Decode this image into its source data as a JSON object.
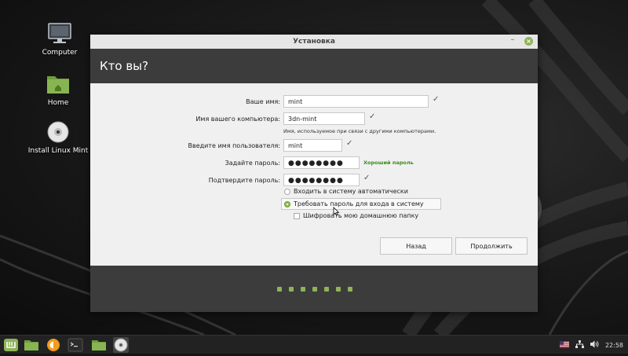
{
  "desktop": {
    "icons": [
      {
        "label": "Computer",
        "icon": "computer-icon"
      },
      {
        "label": "Home",
        "icon": "home-folder-icon"
      },
      {
        "label": "Install Linux Mint",
        "icon": "disc-icon"
      }
    ]
  },
  "window": {
    "title": "Установка",
    "minimize_glyph": "–",
    "close_glyph": "×",
    "header": "Кто вы?",
    "form": {
      "name_label": "Ваше имя:",
      "name_value": "mint",
      "computer_label": "Имя вашего компьютера:",
      "computer_value": "3dn-mint",
      "computer_hint": "Имя, используемое при связи с другими компьютерами.",
      "username_label": "Введите имя пользователя:",
      "username_value": "mint",
      "password_label": "Задайте пароль:",
      "password_value": "●●●●●●●●",
      "password_strength": "Хороший пароль",
      "confirm_label": "Подтвердите пароль:",
      "confirm_value": "●●●●●●●●",
      "check_glyph": "✓",
      "auto_login_label": "Входить в систему автоматически",
      "require_password_label": "Требовать пароль для входа в систему",
      "encrypt_home_label": "Шифровать мою домашнюю папку"
    },
    "buttons": {
      "back": "Назад",
      "continue": "Продолжить"
    },
    "progress": {
      "total_steps": 7
    }
  },
  "taskbar": {
    "apps": [
      "menu-icon",
      "files-icon",
      "firefox-icon",
      "terminal-icon",
      "folder-icon",
      "disc-icon"
    ],
    "tray": {
      "clock": "22:58"
    }
  },
  "colors": {
    "accent": "#8fb359",
    "header_bg": "#3c3c3c",
    "good_password": "#3c8b1e"
  }
}
